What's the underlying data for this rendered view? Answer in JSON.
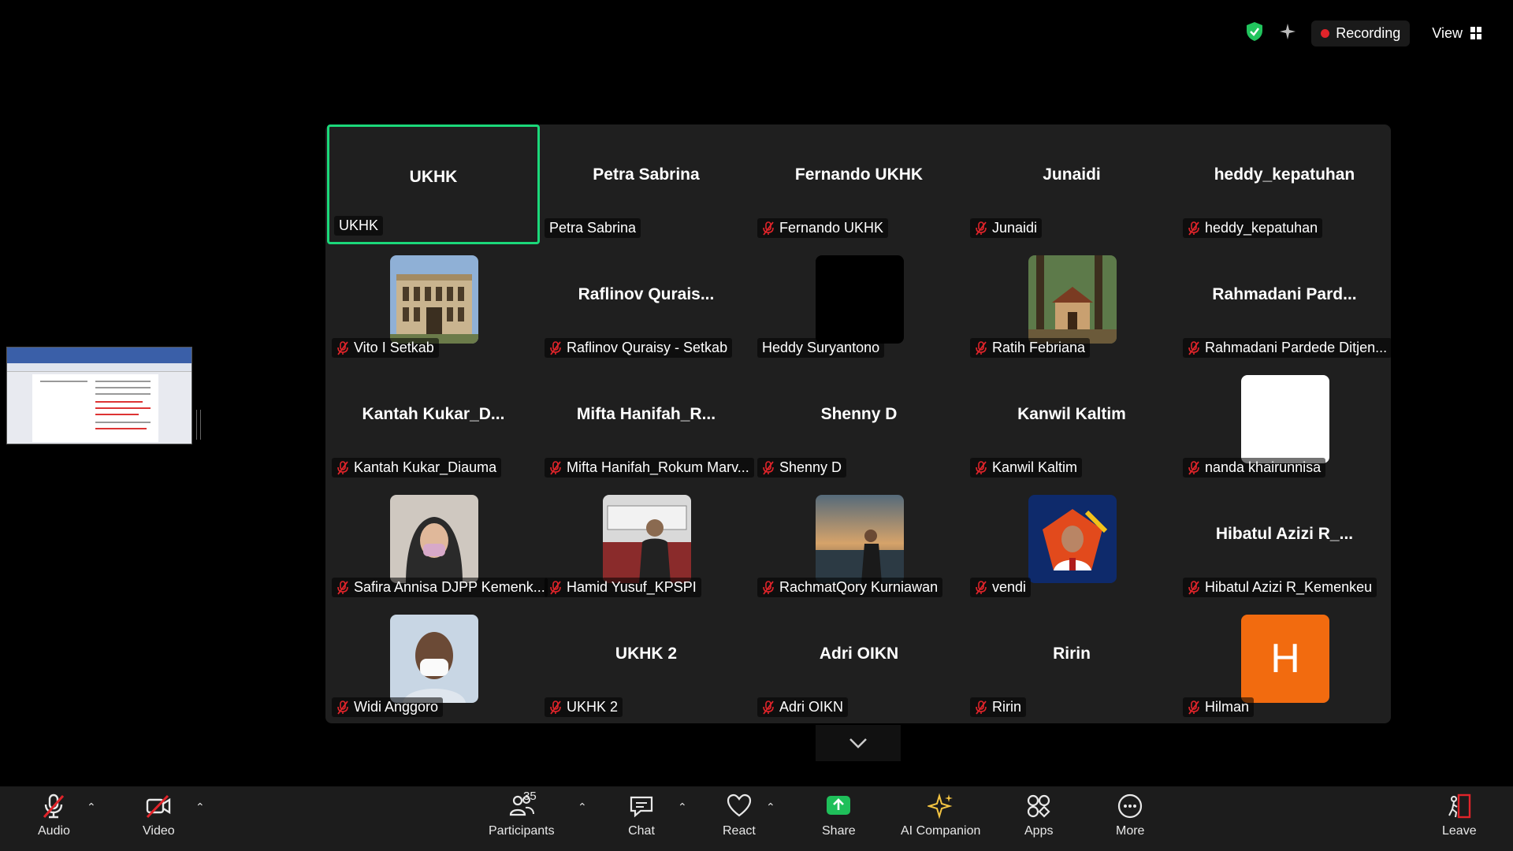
{
  "topbar": {
    "recording_label": "Recording",
    "view_label": "View"
  },
  "tiles": [
    {
      "name": "UKHK",
      "label": "UKHK",
      "muted": false,
      "active": true,
      "avatar": null
    },
    {
      "name": "Petra Sabrina",
      "label": "Petra Sabrina",
      "muted": false,
      "avatar": null
    },
    {
      "name": "Fernando UKHK",
      "label": "Fernando UKHK",
      "muted": true,
      "avatar": null
    },
    {
      "name": "Junaidi",
      "label": "Junaidi",
      "muted": true,
      "avatar": null
    },
    {
      "name": "heddy_kepatuhan",
      "label": "heddy_kepatuhan",
      "muted": true,
      "avatar": null
    },
    {
      "name": "",
      "label": "Vito I Setkab",
      "muted": true,
      "avatar": "building"
    },
    {
      "name": "Raflinov Qurais...",
      "label": "Raflinov Quraisy - Setkab",
      "muted": true,
      "avatar": null
    },
    {
      "name": "",
      "label": "Heddy Suryantono",
      "muted": false,
      "avatar": "black"
    },
    {
      "name": "",
      "label": "Ratih Febriana",
      "muted": true,
      "avatar": "house"
    },
    {
      "name": "Rahmadani Pard...",
      "label": "Rahmadani Pardede Ditjen...",
      "muted": true,
      "avatar": null
    },
    {
      "name": "Kantah Kukar_D...",
      "label": "Kantah Kukar_Diauma",
      "muted": true,
      "avatar": null
    },
    {
      "name": "Mifta Hanifah_R...",
      "label": "Mifta Hanifah_Rokum Marv...",
      "muted": true,
      "avatar": null
    },
    {
      "name": "Shenny D",
      "label": "Shenny D",
      "muted": true,
      "avatar": null
    },
    {
      "name": "Kanwil Kaltim",
      "label": "Kanwil Kaltim",
      "muted": true,
      "avatar": null
    },
    {
      "name": "",
      "label": "nanda khairunnisa",
      "muted": true,
      "avatar": "white"
    },
    {
      "name": "",
      "label": "Safira Annisa DJPP Kemenk...",
      "muted": true,
      "avatar": "hijab"
    },
    {
      "name": "",
      "label": "Hamid Yusuf_KPSPI",
      "muted": true,
      "avatar": "train"
    },
    {
      "name": "",
      "label": "RachmatQory Kurniawan",
      "muted": true,
      "avatar": "sunset"
    },
    {
      "name": "",
      "label": "vendi",
      "muted": true,
      "avatar": "badge"
    },
    {
      "name": "Hibatul Azizi R_...",
      "label": "Hibatul Azizi R_Kemenkeu",
      "muted": true,
      "avatar": null
    },
    {
      "name": "",
      "label": "Widi Anggoro",
      "muted": true,
      "avatar": "mask"
    },
    {
      "name": "UKHK 2",
      "label": "UKHK 2",
      "muted": true,
      "avatar": null
    },
    {
      "name": "Adri OIKN",
      "label": "Adri OIKN",
      "muted": true,
      "avatar": null
    },
    {
      "name": "Ririn",
      "label": "Ririn",
      "muted": true,
      "avatar": null
    },
    {
      "name": "",
      "label": "Hilman",
      "muted": true,
      "avatar": "letter",
      "letter": "H"
    }
  ],
  "toolbar": {
    "audio_label": "Audio",
    "video_label": "Video",
    "participants_label": "Participants",
    "participants_count": "35",
    "chat_label": "Chat",
    "react_label": "React",
    "share_label": "Share",
    "ai_label": "AI Companion",
    "apps_label": "Apps",
    "more_label": "More",
    "leave_label": "Leave"
  },
  "colors": {
    "active_speaker": "#1bd87a",
    "mute_red": "#e0242a",
    "share_green": "#1fbf5a",
    "avatar_orange": "#f26b0f"
  }
}
